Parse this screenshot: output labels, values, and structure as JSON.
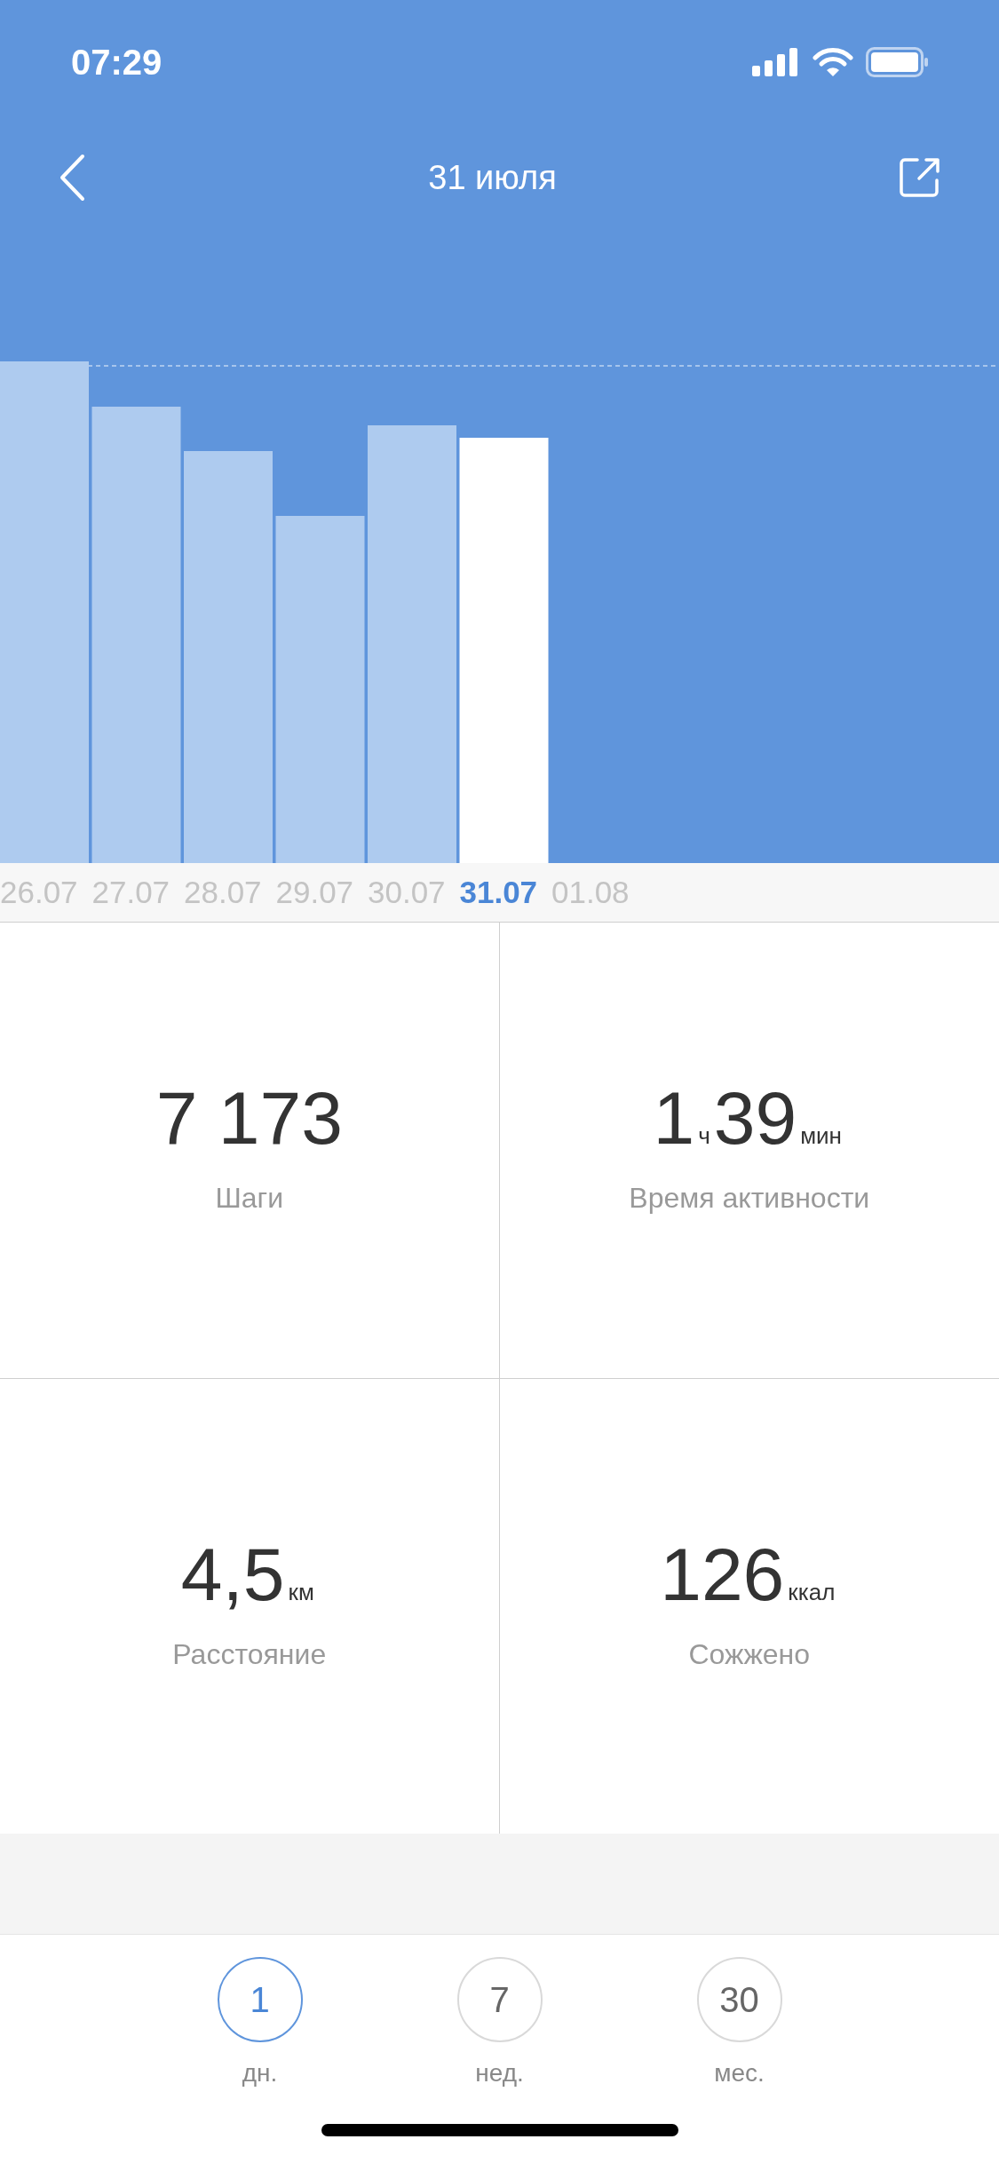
{
  "status_bar": {
    "time": "07:29"
  },
  "header": {
    "title": "31 июля"
  },
  "days": [
    {
      "label": "26.07",
      "selected": false
    },
    {
      "label": "27.07",
      "selected": false
    },
    {
      "label": "28.07",
      "selected": false
    },
    {
      "label": "29.07",
      "selected": false
    },
    {
      "label": "30.07",
      "selected": false
    },
    {
      "label": "31.07",
      "selected": true
    },
    {
      "label": "01.08",
      "selected": false
    }
  ],
  "stats": [
    {
      "kind": "single",
      "value": "7 173",
      "label": "Шаги"
    },
    {
      "kind": "duration",
      "hours": "1",
      "hours_unit": "ч",
      "minutes": "39",
      "minutes_unit": "мин",
      "label": "Время активности"
    },
    {
      "kind": "unit",
      "value": "4,5",
      "unit": "км",
      "label": "Расстояние"
    },
    {
      "kind": "unit",
      "value": "126",
      "unit": "ккал",
      "label": "Сожжено"
    }
  ],
  "periods": [
    {
      "number": "1",
      "label": "дн.",
      "selected": true
    },
    {
      "number": "7",
      "label": "нед.",
      "selected": false
    },
    {
      "number": "30",
      "label": "мес.",
      "selected": false
    }
  ]
}
